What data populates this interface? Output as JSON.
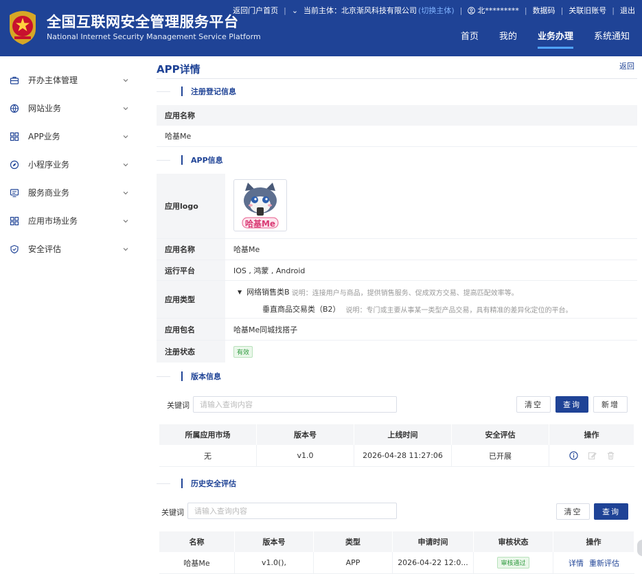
{
  "header": {
    "title": "全国互联网安全管理服务平台",
    "subtitle": "National Internet Security Management Service Platform",
    "top_links": {
      "portal": "返回门户首页",
      "entity_label": "当前主体：北京渐风科技有限公司",
      "switch": "(切换主体)",
      "user": "北*********",
      "data_code": "数据码",
      "link_old": "关联旧账号",
      "logout": "退出"
    },
    "nav": [
      {
        "label": "首页",
        "active": false
      },
      {
        "label": "我的",
        "active": false
      },
      {
        "label": "业务办理",
        "active": true
      },
      {
        "label": "系统通知",
        "active": false
      }
    ],
    "colors": {
      "brand": "#1f4396",
      "accent": "#4fa3ff"
    }
  },
  "sidebar": {
    "items": [
      {
        "label": "开办主体管理",
        "icon": "briefcase-icon"
      },
      {
        "label": "网站业务",
        "icon": "globe-icon"
      },
      {
        "label": "APP业务",
        "icon": "grid-icon"
      },
      {
        "label": "小程序业务",
        "icon": "compass-icon"
      },
      {
        "label": "服务商业务",
        "icon": "monitor-icon"
      },
      {
        "label": "应用市场业务",
        "icon": "grid-icon"
      },
      {
        "label": "安全评估",
        "icon": "shield-icon"
      }
    ]
  },
  "page": {
    "title": "APP详情",
    "back": "返回"
  },
  "registration": {
    "section_title": "注册登记信息",
    "name_label": "应用名称",
    "name_value": "哈基Me"
  },
  "app_info": {
    "section_title": "APP信息",
    "logo_label": "应用logo",
    "logo_text": "哈基Me",
    "name_label": "应用名称",
    "name_value": "哈基Me",
    "platform_label": "运行平台",
    "platform_value": "IOS , 鸿蒙 , Android",
    "type_label": "应用类型",
    "type_main": "网络销售类B",
    "type_main_desc": "说明：连接用户与商品，提供销售服务、促成双方交易、提高匹配效率等。",
    "type_sub": "垂直商品交易类（B2）",
    "type_sub_desc": "说明：专门或主要从事某一类型产品交易，具有精准的差异化定位的平台。",
    "package_label": "应用包名",
    "package_value": "哈基Me同城找搭子",
    "status_label": "注册状态",
    "status_value": "有效"
  },
  "versions": {
    "section_title": "版本信息",
    "keyword_label": "关键词",
    "search_placeholder": "请输入查询内容",
    "clear": "清空",
    "query": "查询",
    "add": "新增",
    "columns": [
      "所属应用市场",
      "版本号",
      "上线时间",
      "安全评估",
      "操作"
    ],
    "rows": [
      {
        "market": "无",
        "version": "v1.0",
        "online_time": "2026-04-28 11:27:06",
        "assessment": "已开展"
      }
    ]
  },
  "history": {
    "section_title": "历史安全评估",
    "keyword_label": "关键词",
    "search_placeholder": "请输入查询内容",
    "clear": "清空",
    "query": "查询",
    "columns": [
      "名称",
      "版本号",
      "类型",
      "申请时间",
      "审核状态",
      "操作"
    ],
    "rows": [
      {
        "name": "哈基Me",
        "version": "v1.0(),",
        "type": "APP",
        "apply_time": "2026-04-22 12:0...",
        "status": "审核通过",
        "op_detail": "详情",
        "op_reassess": "重新评估"
      }
    ]
  }
}
